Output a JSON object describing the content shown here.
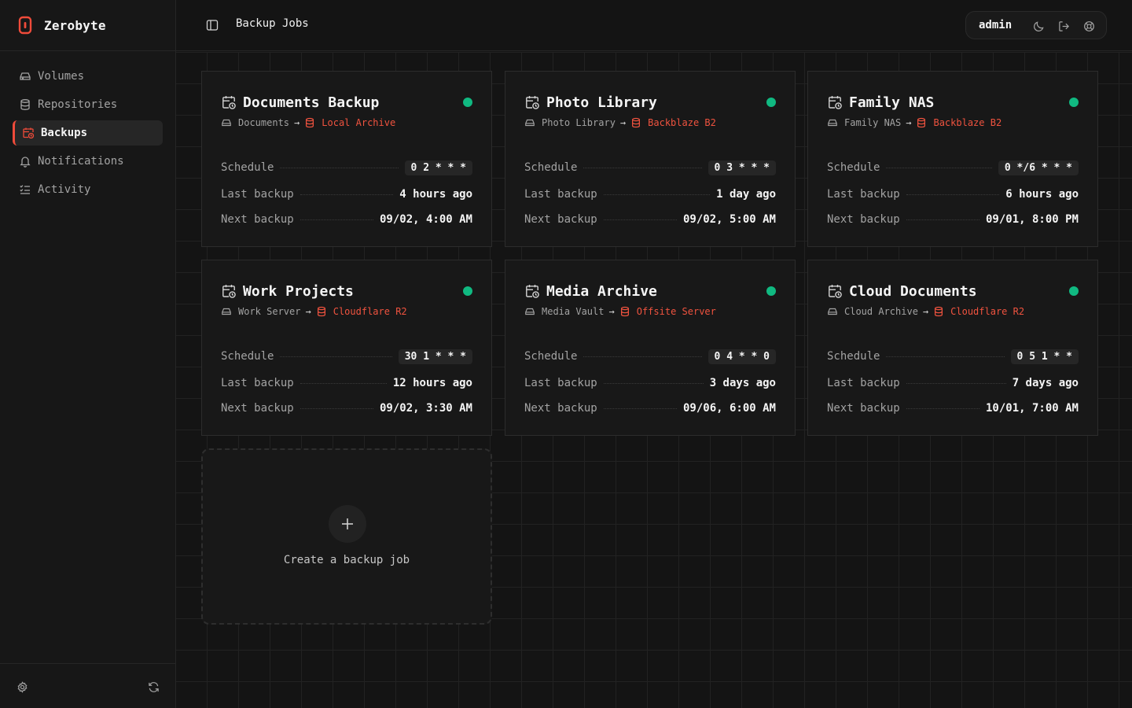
{
  "app": {
    "name": "Zerobyte",
    "accent": "#ef4b3a",
    "status_color": "#10b981"
  },
  "header": {
    "title": "Backup Jobs",
    "user": "admin"
  },
  "sidebar": {
    "items": [
      {
        "label": "Volumes",
        "icon": "hard-drive-icon",
        "active": false
      },
      {
        "label": "Repositories",
        "icon": "database-icon",
        "active": false
      },
      {
        "label": "Backups",
        "icon": "calendar-clock-icon",
        "active": true
      },
      {
        "label": "Notifications",
        "icon": "bell-icon",
        "active": false
      },
      {
        "label": "Activity",
        "icon": "list-checks-icon",
        "active": false
      }
    ]
  },
  "labels": {
    "schedule": "Schedule",
    "last_backup": "Last backup",
    "next_backup": "Next backup"
  },
  "jobs": [
    {
      "name": "Documents Backup",
      "volume": "Documents",
      "repository": "Local Archive",
      "schedule": "0 2 * * *",
      "last_backup": "4 hours ago",
      "next_backup": "09/02, 4:00 AM",
      "status": "active"
    },
    {
      "name": "Photo Library",
      "volume": "Photo Library",
      "repository": "Backblaze B2",
      "schedule": "0 3 * * *",
      "last_backup": "1 day ago",
      "next_backup": "09/02, 5:00 AM",
      "status": "active"
    },
    {
      "name": "Family NAS",
      "volume": "Family NAS",
      "repository": "Backblaze B2",
      "schedule": "0 */6 * * *",
      "last_backup": "6 hours ago",
      "next_backup": "09/01, 8:00 PM",
      "status": "active"
    },
    {
      "name": "Work Projects",
      "volume": "Work Server",
      "repository": "Cloudflare R2",
      "schedule": "30 1 * * *",
      "last_backup": "12 hours ago",
      "next_backup": "09/02, 3:30 AM",
      "status": "active"
    },
    {
      "name": "Media Archive",
      "volume": "Media Vault",
      "repository": "Offsite Server",
      "schedule": "0 4 * * 0",
      "last_backup": "3 days ago",
      "next_backup": "09/06, 6:00 AM",
      "status": "active"
    },
    {
      "name": "Cloud Documents",
      "volume": "Cloud Archive",
      "repository": "Cloudflare R2",
      "schedule": "0 5 1 * *",
      "last_backup": "7 days ago",
      "next_backup": "10/01, 7:00 AM",
      "status": "active"
    }
  ],
  "create": {
    "label": "Create a backup job"
  }
}
